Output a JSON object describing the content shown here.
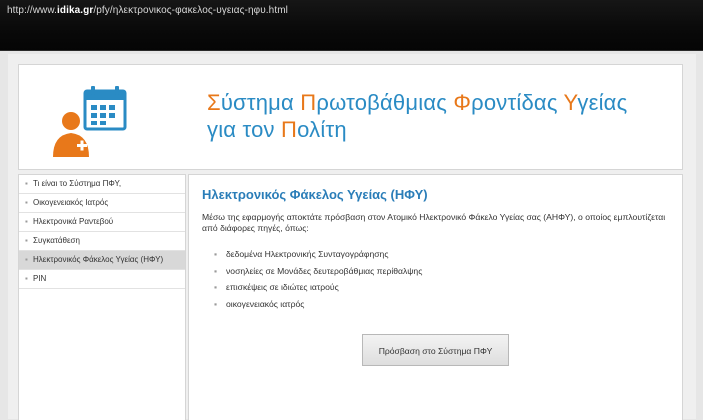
{
  "browser": {
    "url_prefix": "http://www.",
    "url_domain": "idika.gr",
    "url_path": "/pfy/ηλεκτρονικος-φακελος-υγειας-ηφυ.html"
  },
  "header": {
    "title_line1": [
      {
        "text": "Σ",
        "accent": true
      },
      {
        "text": "ύστημα ",
        "accent": false
      },
      {
        "text": "Π",
        "accent": true
      },
      {
        "text": "ρωτοβάθμιας ",
        "accent": false
      },
      {
        "text": "Φ",
        "accent": true
      },
      {
        "text": "ροντίδας ",
        "accent": false
      },
      {
        "text": "Υ",
        "accent": true
      },
      {
        "text": "γείας",
        "accent": false
      }
    ],
    "title_line2": [
      {
        "text": "για τον ",
        "accent": false
      },
      {
        "text": "Π",
        "accent": true
      },
      {
        "text": "ολίτη",
        "accent": false
      }
    ],
    "logo_icon": "doctor-calendar-icon"
  },
  "sidebar": {
    "items": [
      {
        "label": "Τι είναι το Σύστημα ΠΦΥ,",
        "active": false
      },
      {
        "label": "Οικογενειακός Ιατρός",
        "active": false
      },
      {
        "label": "Ηλεκτρονικά Ραντεβού",
        "active": false
      },
      {
        "label": "Συγκατάθεση",
        "active": false
      },
      {
        "label": "Ηλεκτρονικός Φάκελος Υγείας (ΗΦΥ)",
        "active": true
      },
      {
        "label": "PIN",
        "active": false
      }
    ]
  },
  "content": {
    "heading": "Ηλεκτρονικός Φάκελος Υγείας (ΗΦΥ)",
    "intro": "Μέσω της εφαρμογής αποκτάτε πρόσβαση στον Ατομικό Ηλεκτρονικό Φάκελο Υγείας σας (ΑΗΦΥ), ο οποίος εμπλουτίζεται από διάφορες πηγές, όπως:",
    "bullets": [
      "δεδομένα Ηλεκτρονικής Συνταγογράφησης",
      "νοσηλείες σε Μονάδες δευτεροβάθμιας περίθαλψης",
      "επισκέψεις σε ιδιώτες ιατρούς",
      "οικογενειακός ιατρός"
    ],
    "button_label": "Πρόσβαση στο Σύστημα ΠΦΥ"
  },
  "colors": {
    "title_blue": "#2a8bc4",
    "title_accent": "#e8781a",
    "heading_blue": "#2a7db8",
    "active_item_bg": "#d8d8d8"
  }
}
